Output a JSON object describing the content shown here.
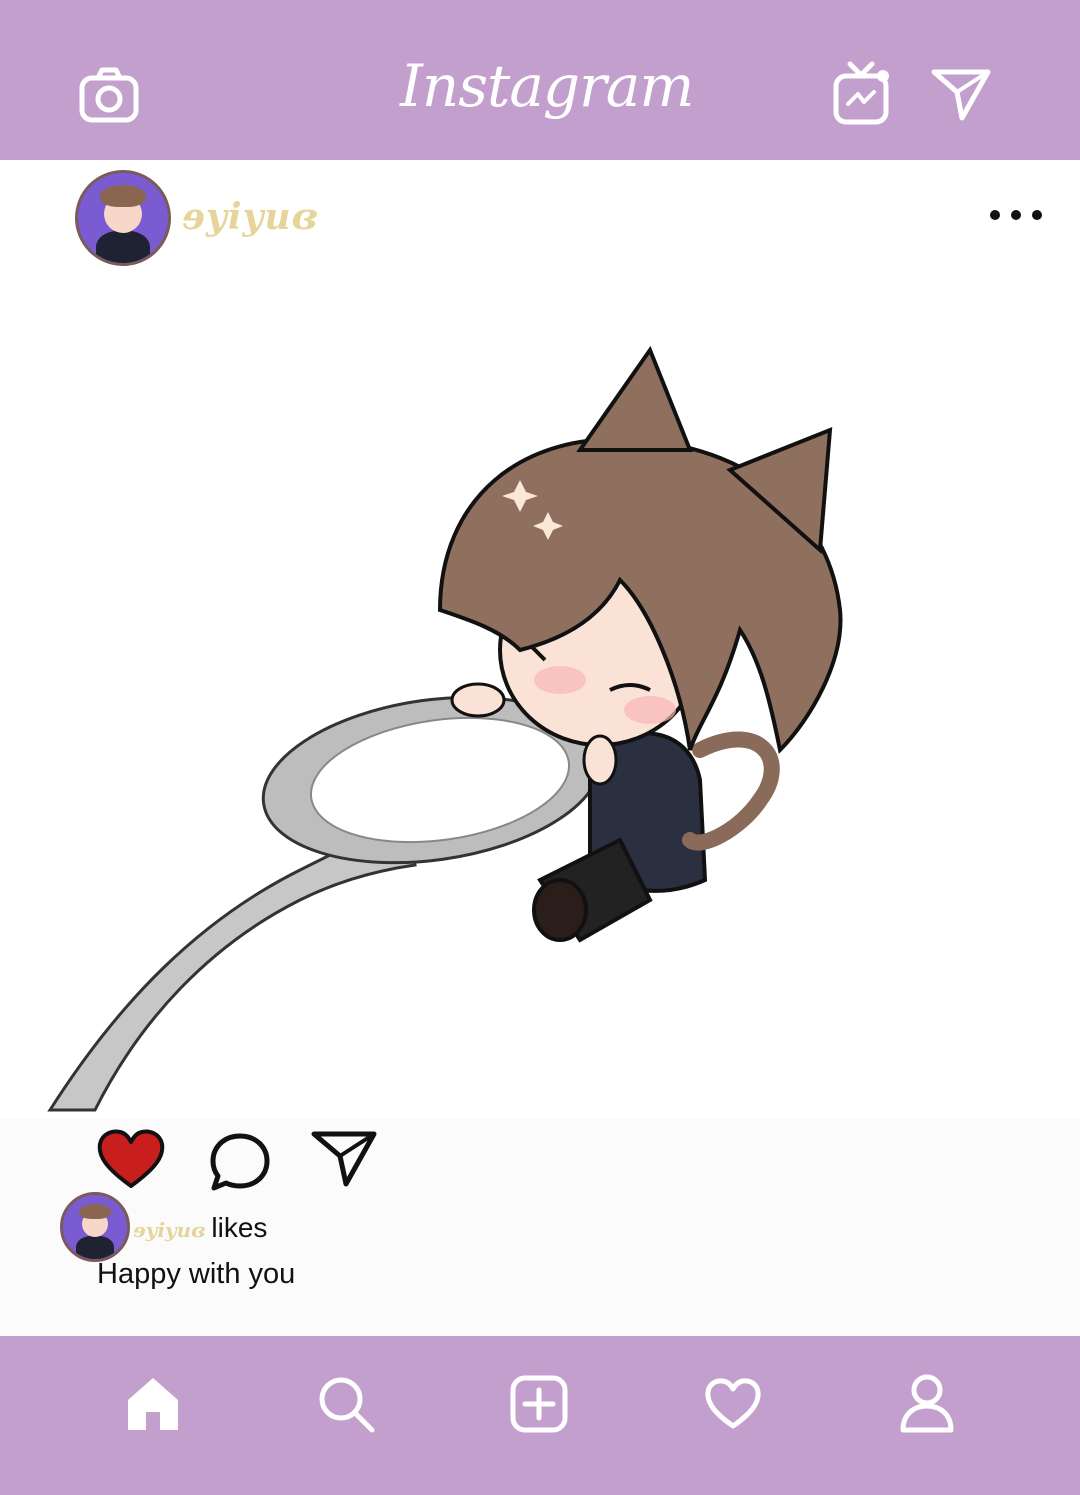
{
  "header": {
    "brand": "Instagram",
    "icons": [
      "camera-icon",
      "igtv-icon",
      "direct-message-icon"
    ]
  },
  "post": {
    "username": "ɘyiyuɞ",
    "more_icon": "more-options-icon",
    "image_description_icon": "chibi-cat-boy-on-spoon-image"
  },
  "actions": {
    "icons": [
      "heart-filled-icon",
      "comment-icon",
      "share-icon"
    ],
    "like_color": "#c81e1e"
  },
  "likes": {
    "user": "ɘyiyuɞ",
    "suffix": "likes"
  },
  "caption": "Happy with you",
  "bottom_nav": {
    "icons": [
      "home-icon",
      "search-icon",
      "add-post-icon",
      "activity-heart-icon",
      "profile-icon"
    ]
  },
  "theme": {
    "bar_color": "#c29fcc",
    "username_color": "#e7d49a"
  }
}
